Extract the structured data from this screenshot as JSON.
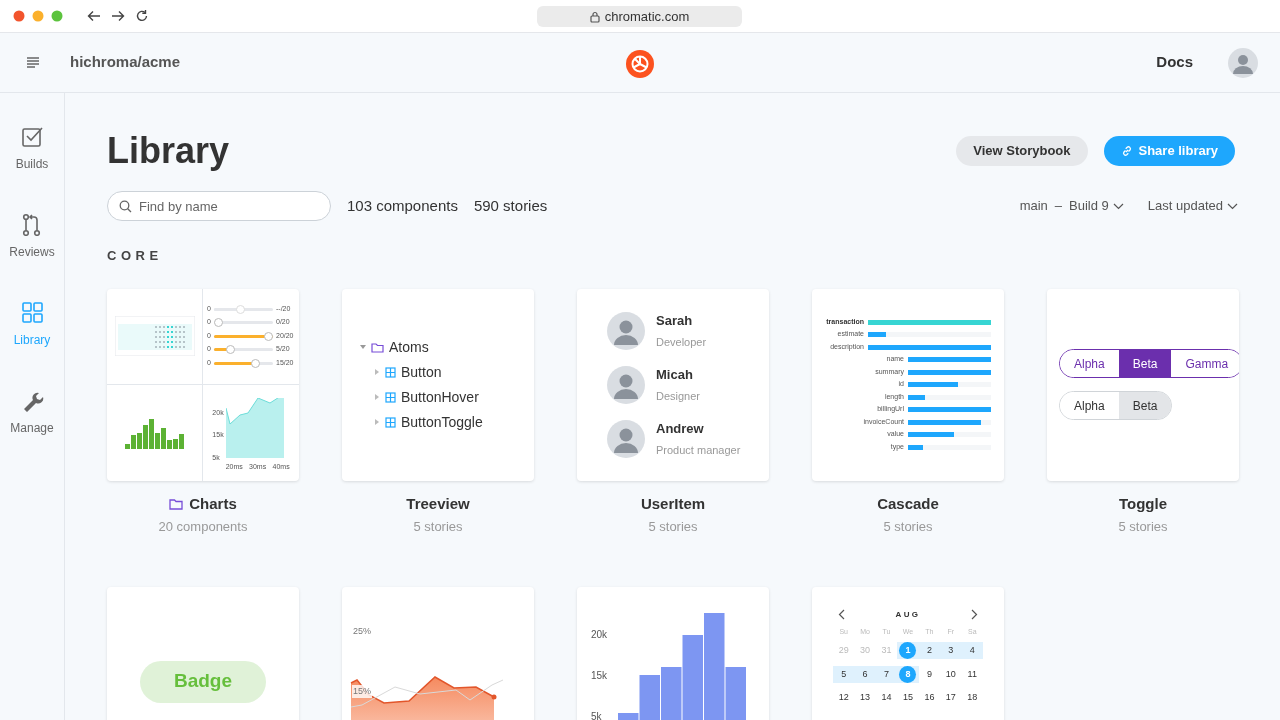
{
  "browser": {
    "url": "chromatic.com"
  },
  "header": {
    "project": "hichroma/acme",
    "docs": "Docs"
  },
  "sidebar": {
    "items": [
      {
        "label": "Builds",
        "kind": "check",
        "selected": false
      },
      {
        "label": "Reviews",
        "kind": "merge",
        "selected": false
      },
      {
        "label": "Library",
        "kind": "grid",
        "selected": true
      },
      {
        "label": "Manage",
        "kind": "wrench",
        "selected": false
      }
    ]
  },
  "page": {
    "title": "Library",
    "buttons": [
      {
        "label": "View Storybook",
        "kind": "secondary"
      },
      {
        "label": "Share library",
        "kind": "primary"
      }
    ],
    "search": {
      "placeholder": "Find by name"
    },
    "counts": [
      "103 components",
      "590 stories"
    ],
    "branch": "main",
    "separator": "–",
    "build": "Build 9",
    "sort": "Last updated"
  },
  "section": "CORE",
  "cards": [
    {
      "kind": "charts",
      "title": "Charts",
      "subtitle": "20 components",
      "folder": true,
      "sliders": [
        {
          "min": "0",
          "level": 0.45,
          "disabled": true,
          "reading": "--/20"
        },
        {
          "min": "0",
          "level": 0,
          "disabled": false,
          "reading": "0/20"
        },
        {
          "min": "0",
          "level": 1,
          "disabled": false,
          "reading": "20/20"
        },
        {
          "min": "0",
          "level": 0.25,
          "disabled": false,
          "reading": "5/20"
        },
        {
          "min": "0",
          "level": 0.75,
          "disabled": false,
          "reading": "15/20"
        }
      ],
      "area_ticks": [
        "20k",
        "15k",
        "5k"
      ],
      "area_x": [
        "20ms",
        "30ms",
        "40ms"
      ]
    },
    {
      "kind": "treeview",
      "title": "Treeview",
      "subtitle": "5 stories",
      "folder": false,
      "tree": [
        {
          "label": "Atoms",
          "kind": "folder",
          "expanded": true,
          "children": [
            {
              "label": "Button",
              "kind": "component",
              "expanded": false
            },
            {
              "label": "ButtonHover",
              "kind": "component",
              "expanded": false
            },
            {
              "label": "ButtonToggle",
              "kind": "component",
              "expanded": false
            }
          ]
        }
      ]
    },
    {
      "kind": "useritem",
      "title": "UserItem",
      "subtitle": "5 stories",
      "folder": false,
      "users": [
        {
          "name": "Sarah",
          "role": "Developer"
        },
        {
          "name": "Micah",
          "role": "Designer"
        },
        {
          "name": "Andrew",
          "role": "Product manager"
        }
      ]
    },
    {
      "kind": "cascade",
      "title": "Cascade",
      "subtitle": "5 stories",
      "folder": false,
      "rows": [
        {
          "label": "transaction",
          "level": 1,
          "highlighted": true
        },
        {
          "label": "estimate",
          "level": 0.15,
          "highlighted": false
        },
        {
          "label": "description",
          "level": 1,
          "highlighted": false,
          "children": [
            {
              "label": "name",
              "level": 1,
              "highlighted": false
            },
            {
              "label": "summary",
              "level": 1,
              "highlighted": false
            },
            {
              "label": "id",
              "level": 0.6,
              "highlighted": false
            },
            {
              "label": "length",
              "level": 0.2,
              "highlighted": false
            },
            {
              "label": "billingUrl",
              "level": 1,
              "highlighted": false
            },
            {
              "label": "invoiceCount",
              "level": 0.88,
              "highlighted": false
            },
            {
              "label": "value",
              "level": 0.55,
              "highlighted": false
            },
            {
              "label": "type",
              "level": 0.18,
              "highlighted": false
            }
          ]
        }
      ]
    },
    {
      "kind": "toggle",
      "title": "Toggle",
      "subtitle": "5 stories",
      "folder": false,
      "groups": [
        {
          "kind": "outline",
          "options": [
            {
              "label": "Alpha",
              "selected": false
            },
            {
              "label": "Beta",
              "selected": true
            },
            {
              "label": "Gamma",
              "selected": false
            }
          ]
        },
        {
          "kind": "filled",
          "options": [
            {
              "label": "Alpha",
              "selected": false
            },
            {
              "label": "Beta",
              "selected": true
            }
          ]
        }
      ]
    },
    {
      "kind": "badge",
      "label": "Badge",
      "color": "#66bf3c"
    },
    {
      "kind": "area",
      "yticks": [
        "25%",
        "15%"
      ]
    },
    {
      "kind": "bars",
      "yticks": [
        "20k",
        "15k",
        "5k"
      ]
    },
    {
      "kind": "calendar",
      "month": "AUG",
      "weekdays": [
        "Su",
        "Mo",
        "Tu",
        "We",
        "Th",
        "Fr",
        "Sa"
      ],
      "weeks": [
        [
          {
            "label": "29",
            "muted": true,
            "selected": false,
            "in_range": false
          },
          {
            "label": "30",
            "muted": true,
            "selected": false,
            "in_range": false
          },
          {
            "label": "31",
            "muted": true,
            "selected": false,
            "in_range": false
          },
          {
            "label": "1",
            "muted": false,
            "selected": true,
            "in_range": true
          },
          {
            "label": "2",
            "muted": false,
            "selected": false,
            "in_range": true
          },
          {
            "label": "3",
            "muted": false,
            "selected": false,
            "in_range": true
          },
          {
            "label": "4",
            "muted": false,
            "selected": false,
            "in_range": true
          }
        ],
        [
          {
            "label": "5",
            "muted": false,
            "selected": false,
            "in_range": true
          },
          {
            "label": "6",
            "muted": false,
            "selected": false,
            "in_range": true
          },
          {
            "label": "7",
            "muted": false,
            "selected": false,
            "in_range": true
          },
          {
            "label": "8",
            "muted": false,
            "selected": true,
            "in_range": true
          },
          {
            "label": "9",
            "muted": false,
            "selected": false,
            "in_range": false
          },
          {
            "label": "10",
            "muted": false,
            "selected": false,
            "in_range": false
          },
          {
            "label": "11",
            "muted": false,
            "selected": false,
            "in_range": false
          }
        ],
        [
          {
            "label": "12",
            "muted": false,
            "selected": false,
            "in_range": false
          },
          {
            "label": "13",
            "muted": false,
            "selected": false,
            "in_range": false
          },
          {
            "label": "14",
            "muted": false,
            "selected": false,
            "in_range": false
          },
          {
            "label": "15",
            "muted": false,
            "selected": false,
            "in_range": false
          },
          {
            "label": "16",
            "muted": false,
            "selected": false,
            "in_range": false
          },
          {
            "label": "17",
            "muted": false,
            "selected": false,
            "in_range": false
          },
          {
            "label": "18",
            "muted": false,
            "selected": false,
            "in_range": false
          }
        ]
      ]
    }
  ]
}
